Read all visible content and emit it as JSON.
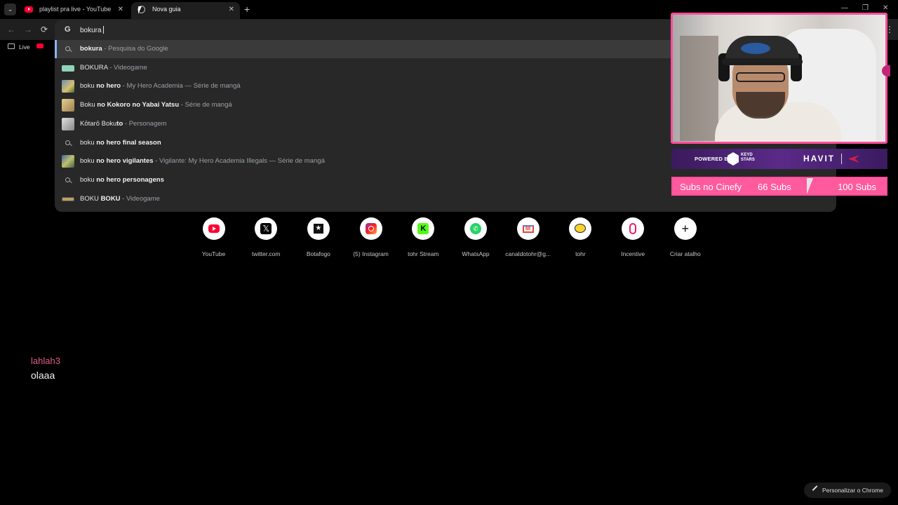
{
  "tabs": [
    {
      "title": "playlist pra live - YouTube",
      "close": "✕"
    },
    {
      "title": "Nova guia",
      "close": "✕"
    }
  ],
  "tab_search_icon": "⌄",
  "new_tab": "+",
  "window_controls": {
    "minimize": "—",
    "maximize": "❐",
    "close": "✕"
  },
  "toolbar": {
    "back": "←",
    "forward": "→",
    "reload": "⟳",
    "menu": "⋮"
  },
  "omnibox": {
    "engine_icon": "G",
    "value": "bokura",
    "suggestions": [
      {
        "plain": "",
        "bold": "bokura",
        "desc": " - Pesquisa do Google",
        "icon": "search-icon"
      },
      {
        "plain": "BOKURA",
        "bold": "",
        "desc": " - Videogame",
        "icon": "game-thumbnail"
      },
      {
        "plain": "boku ",
        "bold": "no hero",
        "desc": " - My Hero Academia — Série de mangá",
        "icon": "thumbnail"
      },
      {
        "plain": "Boku ",
        "bold": "no Kokoro no Yabai Yatsu",
        "desc": " - Série de mangá",
        "icon": "thumbnail"
      },
      {
        "plain": "Kōtarō Boku",
        "bold": "to",
        "desc": " - Personagem",
        "icon": "thumbnail"
      },
      {
        "plain": "boku ",
        "bold": "no hero final season",
        "desc": "",
        "icon": "search-icon"
      },
      {
        "plain": "boku ",
        "bold": "no hero vigilantes",
        "desc": " - Vigilante: My Hero Academia Illegals — Série de mangá",
        "icon": "thumbnail"
      },
      {
        "plain": "boku ",
        "bold": "no hero personagens",
        "desc": "",
        "icon": "search-icon"
      },
      {
        "plain": "BOKU ",
        "bold": "BOKU",
        "desc": " - Videogame",
        "icon": "game-thumbnail"
      }
    ]
  },
  "bookmarks": [
    {
      "label": "Live"
    }
  ],
  "shortcuts": [
    {
      "label": "YouTube",
      "icon": "youtube-icon"
    },
    {
      "label": "twitter.com",
      "icon": "x-icon",
      "glyph": "𝕏"
    },
    {
      "label": "Botafogo",
      "icon": "star-icon",
      "glyph": "★"
    },
    {
      "label": "(5) Instagram",
      "icon": "instagram-icon"
    },
    {
      "label": "tohr Stream",
      "icon": "kick-icon",
      "glyph": "K"
    },
    {
      "label": "WhatsApp",
      "icon": "whatsapp-icon",
      "glyph": "✆"
    },
    {
      "label": "canaldotohr@g...",
      "icon": "gmail-icon"
    },
    {
      "label": "tohr",
      "icon": "tohr-icon"
    },
    {
      "label": "Incentive",
      "icon": "incentive-icon"
    },
    {
      "label": "Criar atalho",
      "icon": "plus-icon",
      "glyph": "+"
    }
  ],
  "chat": {
    "user": "lahlah3",
    "message": "olaaa"
  },
  "customize_label": "Personalizar o Chrome",
  "sponsor": {
    "powered": "POWERED BY",
    "keyd": "KEYD STARS",
    "brand": "HAVIT"
  },
  "subs": {
    "label": "Subs no Cinefy",
    "current": "66 Subs",
    "goal": "100 Subs",
    "progress": 0.66
  },
  "colors": {
    "accent_pink": "#ff4f9a",
    "suggestion_highlight": "#8ab4f8",
    "youtube_red": "#ff0033"
  }
}
